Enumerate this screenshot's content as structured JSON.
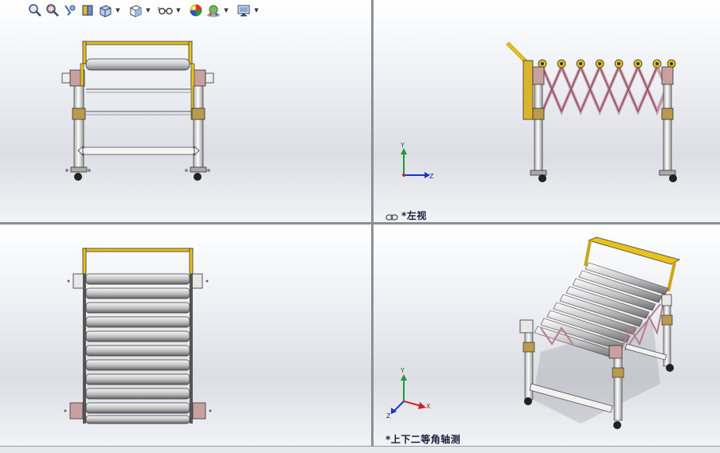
{
  "toolbar": {
    "tools": [
      {
        "name": "zoom-to-fit",
        "icon": "magnifier-icon"
      },
      {
        "name": "zoom-to-area",
        "icon": "magnifier-area-icon"
      },
      {
        "name": "previous-view",
        "icon": "previous-view-icon"
      },
      {
        "name": "section-view",
        "icon": "section-view-icon"
      },
      {
        "name": "view-orientation",
        "icon": "view-orientation-icon"
      },
      {
        "name": "display-style",
        "icon": "display-style-icon"
      },
      {
        "name": "hide-show-items",
        "icon": "glasses-icon"
      },
      {
        "name": "edit-appearance",
        "icon": "appearance-sphere-icon"
      },
      {
        "name": "apply-scene",
        "icon": "scene-icon"
      },
      {
        "name": "view-settings",
        "icon": "monitor-icon"
      }
    ]
  },
  "viewports": {
    "top_right": {
      "label": "*左视",
      "triad": {
        "x": "",
        "y": "Y",
        "z": "Z"
      }
    },
    "bottom_right": {
      "label": "*上下二等角轴测",
      "triad": {
        "x": "X",
        "y": "Y",
        "z": "Z"
      }
    }
  },
  "colors": {
    "accent_yellow": "#e8c21a",
    "scissor_pink": "#c99aa8",
    "bronze": "#b99a4e",
    "axis_x": "#d22020",
    "axis_y": "#1f9a3a",
    "axis_z": "#2030c8"
  }
}
